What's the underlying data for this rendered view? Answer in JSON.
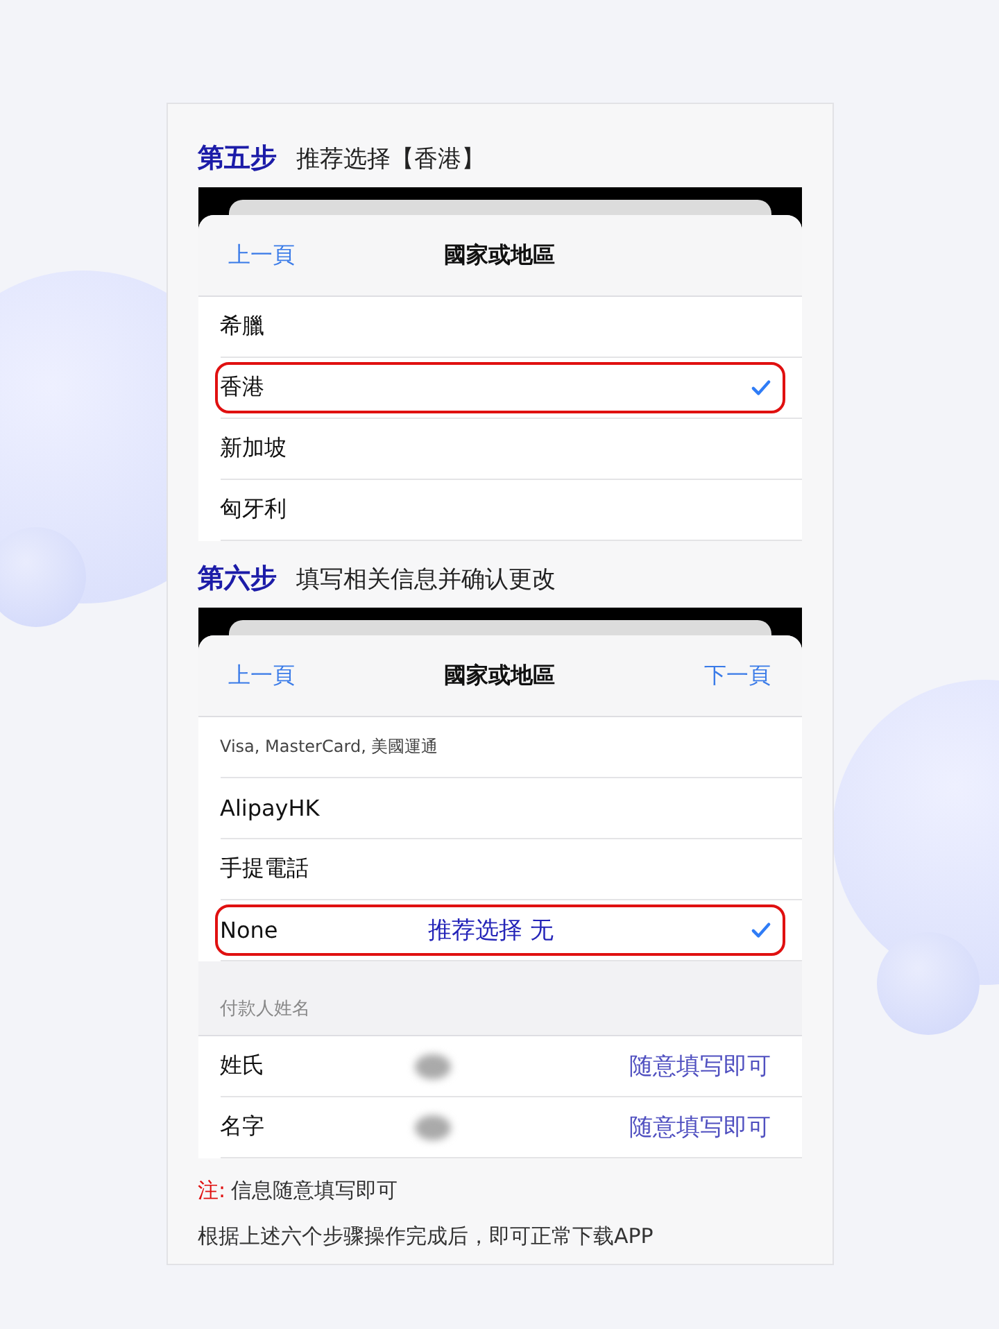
{
  "steps": [
    {
      "step": "第五步",
      "title": "推荐选择【香港】",
      "screen": {
        "back": "上一頁",
        "title": "國家或地區",
        "rows": [
          {
            "label": "希臘",
            "selected": false
          },
          {
            "label": "香港",
            "selected": true
          },
          {
            "label": "新加坡",
            "selected": false
          },
          {
            "label": "匈牙利",
            "selected": false
          }
        ]
      }
    },
    {
      "step": "第六步",
      "title": "填写相关信息并确认更改",
      "screen": {
        "back": "上一頁",
        "title": "國家或地區",
        "next": "下一頁",
        "rows": [
          {
            "label": "Visa, MasterCard, 美國運通",
            "selected": false
          },
          {
            "label": "AlipayHK",
            "selected": false
          },
          {
            "label": "手提電話",
            "selected": false
          },
          {
            "label": "None",
            "selected": true,
            "note": "推荐选择 无"
          }
        ],
        "section": "付款人姓名",
        "fields": [
          {
            "label": "姓氏",
            "hint": "随意填写即可"
          },
          {
            "label": "名字",
            "hint": "随意填写即可"
          }
        ]
      }
    }
  ],
  "note": {
    "mark": "注:",
    "text": "信息随意填写即可"
  },
  "footer": "根据上述六个步骤操作完成后，即可正常下载APP"
}
